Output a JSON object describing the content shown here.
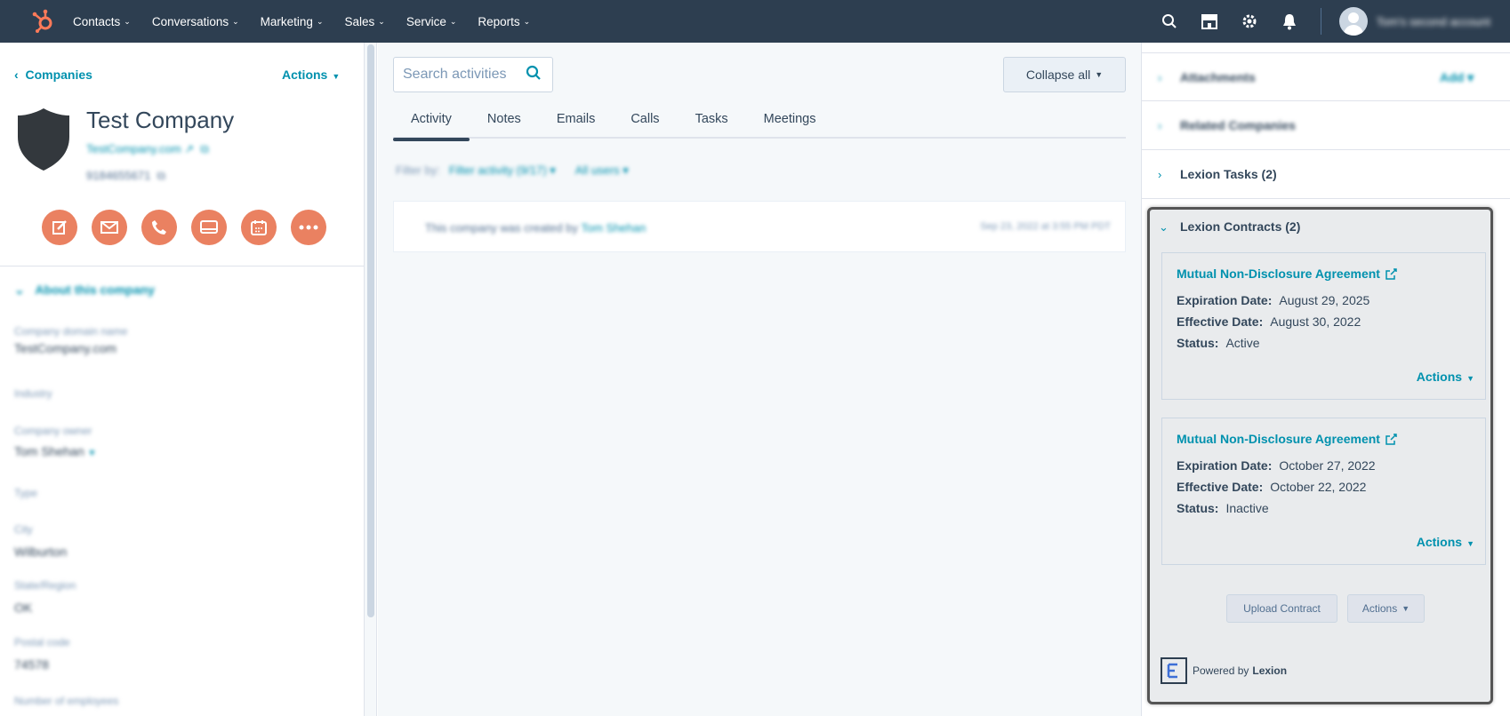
{
  "nav": {
    "items": [
      "Contacts",
      "Conversations",
      "Marketing",
      "Sales",
      "Service",
      "Reports"
    ],
    "account_name": "Tom's second account",
    "icons": [
      "search-icon",
      "marketplace-icon",
      "gear-icon",
      "bell-icon"
    ],
    "brand_color": "#ff7a59",
    "bg_color": "#2d3e50"
  },
  "left": {
    "back_label": "Companies",
    "actions_label": "Actions",
    "company_name": "Test Company",
    "domain": "TestCompany.com",
    "phone": "9184655671",
    "action_buttons": [
      "note",
      "email",
      "call",
      "log",
      "meeting",
      "more"
    ],
    "about_label": "About this company",
    "properties": [
      {
        "label": "Company domain name",
        "value": "TestCompany.com"
      },
      {
        "label": "Industry",
        "value": ""
      },
      {
        "label": "Company owner",
        "value": "Tom Shehan"
      },
      {
        "label": "Type",
        "value": ""
      },
      {
        "label": "City",
        "value": "Wilburton"
      },
      {
        "label": "State/Region",
        "value": "OK"
      },
      {
        "label": "Postal code",
        "value": "74578"
      },
      {
        "label": "Number of employees",
        "value": ""
      }
    ]
  },
  "middle": {
    "search_placeholder": "Search activities",
    "collapse_label": "Collapse all",
    "tabs": [
      "Activity",
      "Notes",
      "Emails",
      "Calls",
      "Tasks",
      "Meetings"
    ],
    "filter_label": "Filter by:",
    "filter_activity": "Filter activity (9/17)",
    "filter_users": "All users",
    "activity_text": "This company was created by",
    "activity_user": "Tom Shehan",
    "activity_date": "Sep 23, 2022 at 3:55 PM PDT"
  },
  "right": {
    "attachments": "Attachments",
    "add_label": "Add",
    "related_companies": "Related Companies",
    "lexion_tasks": "Lexion Tasks (2)",
    "lexion_contracts": "Lexion Contracts (2)",
    "contracts": [
      {
        "title": "Mutual Non-Disclosure Agreement",
        "expiration_label": "Expiration Date:",
        "expiration": "August 29, 2025",
        "effective_label": "Effective Date:",
        "effective": "August 30, 2022",
        "status_label": "Status:",
        "status": "Active",
        "actions": "Actions"
      },
      {
        "title": "Mutual Non-Disclosure Agreement",
        "expiration_label": "Expiration Date:",
        "expiration": "October 27, 2022",
        "effective_label": "Effective Date:",
        "effective": "October 22, 2022",
        "status_label": "Status:",
        "status": "Inactive",
        "actions": "Actions"
      }
    ],
    "upload_label": "Upload Contract",
    "actions_label": "Actions",
    "powered_by": "Powered by",
    "powered_brand": "Lexion"
  }
}
